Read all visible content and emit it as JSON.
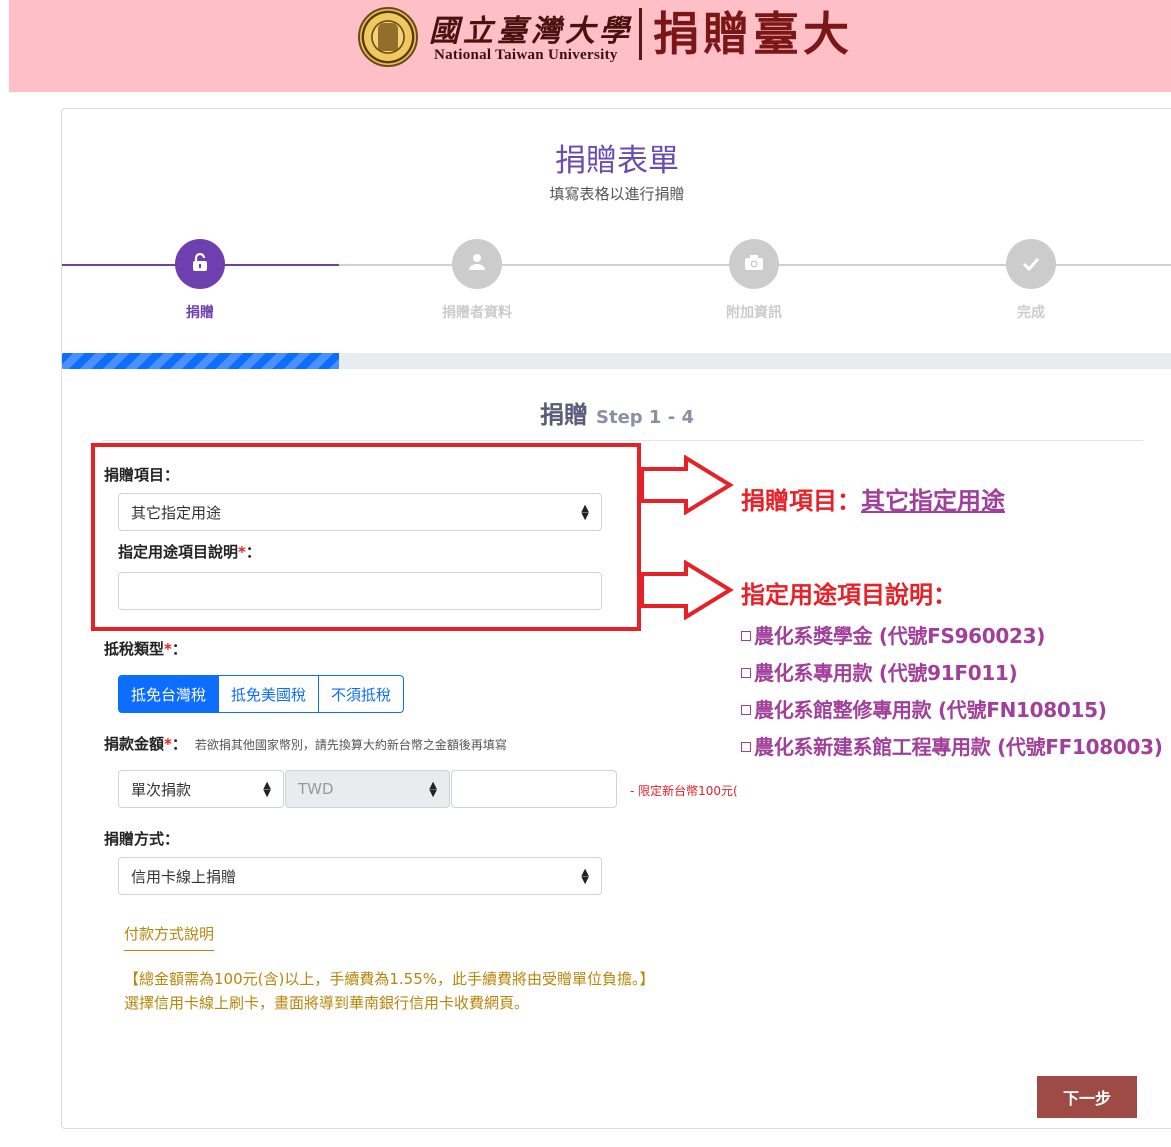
{
  "header": {
    "university_cn": "國立臺灣大學",
    "university_en": "National Taiwan University",
    "site_title": "捐贈臺大",
    "background_color": "#ffbfc6"
  },
  "form": {
    "title": "捐贈表單",
    "subtitle": "填寫表格以進行捐贈",
    "steps": [
      {
        "label": "捐贈",
        "icon": "unlock-icon",
        "active": true
      },
      {
        "label": "捐贈者資料",
        "icon": "user-icon",
        "active": false
      },
      {
        "label": "附加資訊",
        "icon": "camera-icon",
        "active": false
      },
      {
        "label": "完成",
        "icon": "check-icon",
        "active": false
      }
    ],
    "progress_fraction": 0.25,
    "step_heading": "捐贈",
    "step_counter": "Step 1 - 4",
    "donation_item": {
      "label": "捐贈項目：",
      "value": "其它指定用途"
    },
    "designated_desc": {
      "label": "指定用途項目說明",
      "required_mark": "*",
      "suffix": "：",
      "value": ""
    },
    "tax_type": {
      "label": "抵稅類型",
      "required_mark": "*",
      "suffix": "：",
      "options": [
        "抵免台灣稅",
        "抵免美國稅",
        "不須抵稅"
      ],
      "selected": "抵免台灣稅"
    },
    "amount": {
      "label": "捐款金額",
      "required_mark": "*",
      "suffix": "：",
      "hint": "若欲捐其他國家幣別，請先換算大約新台幣之金額後再填寫",
      "frequency": "單次捐款",
      "currency": "TWD",
      "value": "",
      "limit_note": "- 限定新台幣100元("
    },
    "method": {
      "label": "捐贈方式：",
      "value": "信用卡線上捐贈"
    },
    "payment_info_link": "付款方式說明",
    "payment_note_1": "【總金額需為100元(含)以上，手續費為1.55%，此手續費將由受贈單位負擔。】",
    "payment_note_2": "選擇信用卡線上刷卡，畫面將導到華南銀行信用卡收費網頁。",
    "next_button": "下一步"
  },
  "annotations": {
    "item_prefix": "捐贈項目：",
    "item_value": "其它指定用途",
    "desc_heading": "指定用途項目說明：",
    "codes": [
      "農化系獎學金 (代號FS960023)",
      "農化系專用款 (代號91F011)",
      "農化系館整修專用款 (代號FN108015)",
      "農化系新建系館工程專用款 (代號FF108003)"
    ],
    "highlight_color": "#e62128",
    "accent_color": "#a0409a"
  }
}
